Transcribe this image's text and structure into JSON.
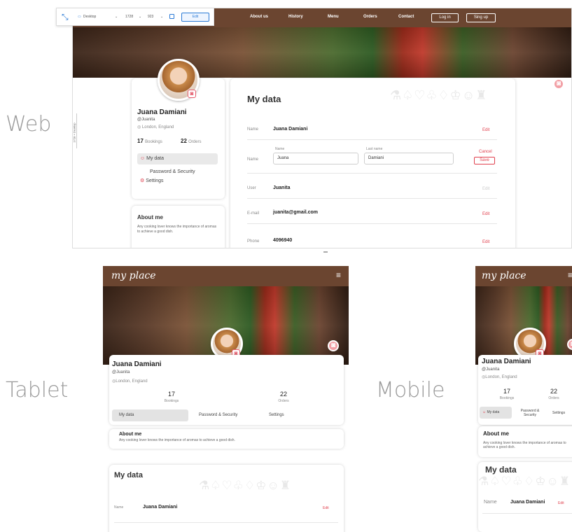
{
  "labels": {
    "web": "Web",
    "tablet": "Tablet",
    "mobile": "Mobile"
  },
  "toolbar": {
    "device": "Desktop",
    "width": "1728",
    "height": "923",
    "edit": "Edit",
    "side": "1728 × Desktop"
  },
  "nav": {
    "about": "About us",
    "history": "History",
    "menu": "Menu",
    "orders": "Orders",
    "contact": "Contact",
    "login": "Log in",
    "signup": "Sing up"
  },
  "brand": "my place",
  "profile": {
    "name": "Juana Damiani",
    "user": "@Juanita",
    "location": "London, England",
    "bookings_num": "17",
    "bookings_label": "Bookings",
    "orders_num": "22",
    "orders_label": "Orders",
    "menu": {
      "mydata": "My data",
      "password": "Password & Security",
      "password_short": "Password\n& Security",
      "settings": "Settings"
    }
  },
  "about": {
    "title": "About me",
    "text": "Any cooking lover knows the importance of aromas to achieve a good dish."
  },
  "mydata": {
    "title": "My data",
    "name_label": "Name",
    "name_value": "Juana Damiani",
    "first_label": "Name",
    "first_value": "Juana",
    "last_label": "Last name",
    "last_value": "Damiani",
    "user_label": "User",
    "user_value": "Juanita",
    "email_label": "E-mail",
    "email_value": "juanita@gmail.com",
    "phone_label": "Phone",
    "phone_value": "4096940",
    "edit": "Edit",
    "cancel": "Cancel",
    "save": "Save"
  },
  "icons_strip": "⚗♤♡♧♢♔☺♜",
  "colors": {
    "nav": "#6b4530",
    "accent": "#e0404e"
  }
}
